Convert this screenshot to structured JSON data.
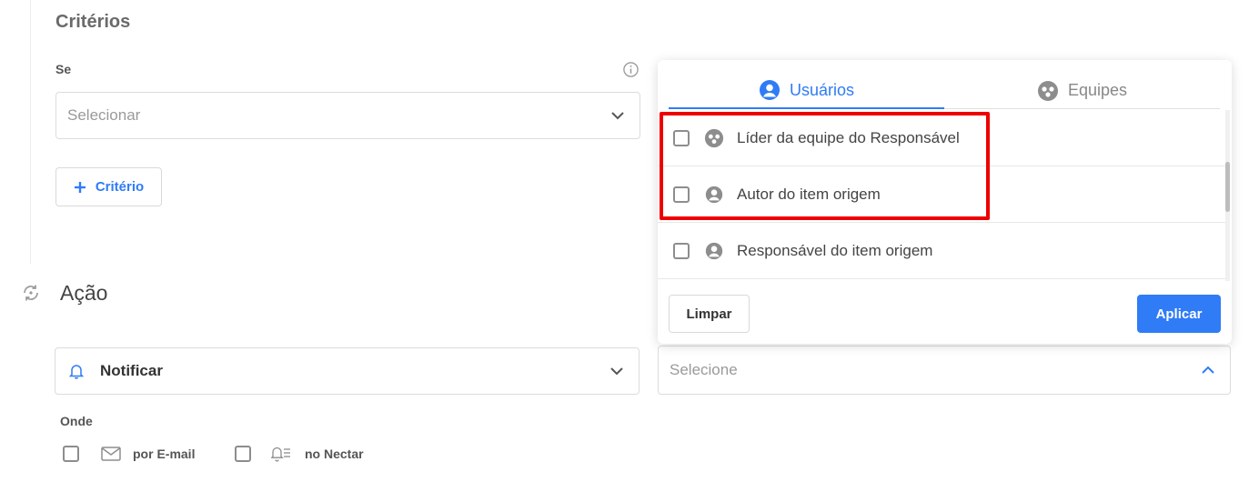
{
  "criteria": {
    "title": "Critérios",
    "if_label": "Se",
    "select_placeholder": "Selecionar",
    "add_button_label": "Critério"
  },
  "action": {
    "title": "Ação",
    "type_value": "Notificar",
    "where_label": "Onde",
    "by_email_label": "por E-mail",
    "in_nectar_label": "no Nectar",
    "recipient_placeholder": "Selecione"
  },
  "dropdown": {
    "tabs": [
      {
        "label": "Usuários",
        "active": true
      },
      {
        "label": "Equipes",
        "active": false
      }
    ],
    "items": [
      {
        "label": "Líder da equipe do Responsável",
        "icon": "team-icon",
        "checked": false
      },
      {
        "label": "Autor do item origem",
        "icon": "user-icon",
        "checked": false
      },
      {
        "label": "Responsável do item origem",
        "icon": "user-icon",
        "checked": false
      }
    ],
    "clear_label": "Limpar",
    "apply_label": "Aplicar"
  },
  "colors": {
    "accent": "#2f7cf6",
    "highlight": "#ee0000",
    "muted_icon": "#8d8d8d"
  }
}
